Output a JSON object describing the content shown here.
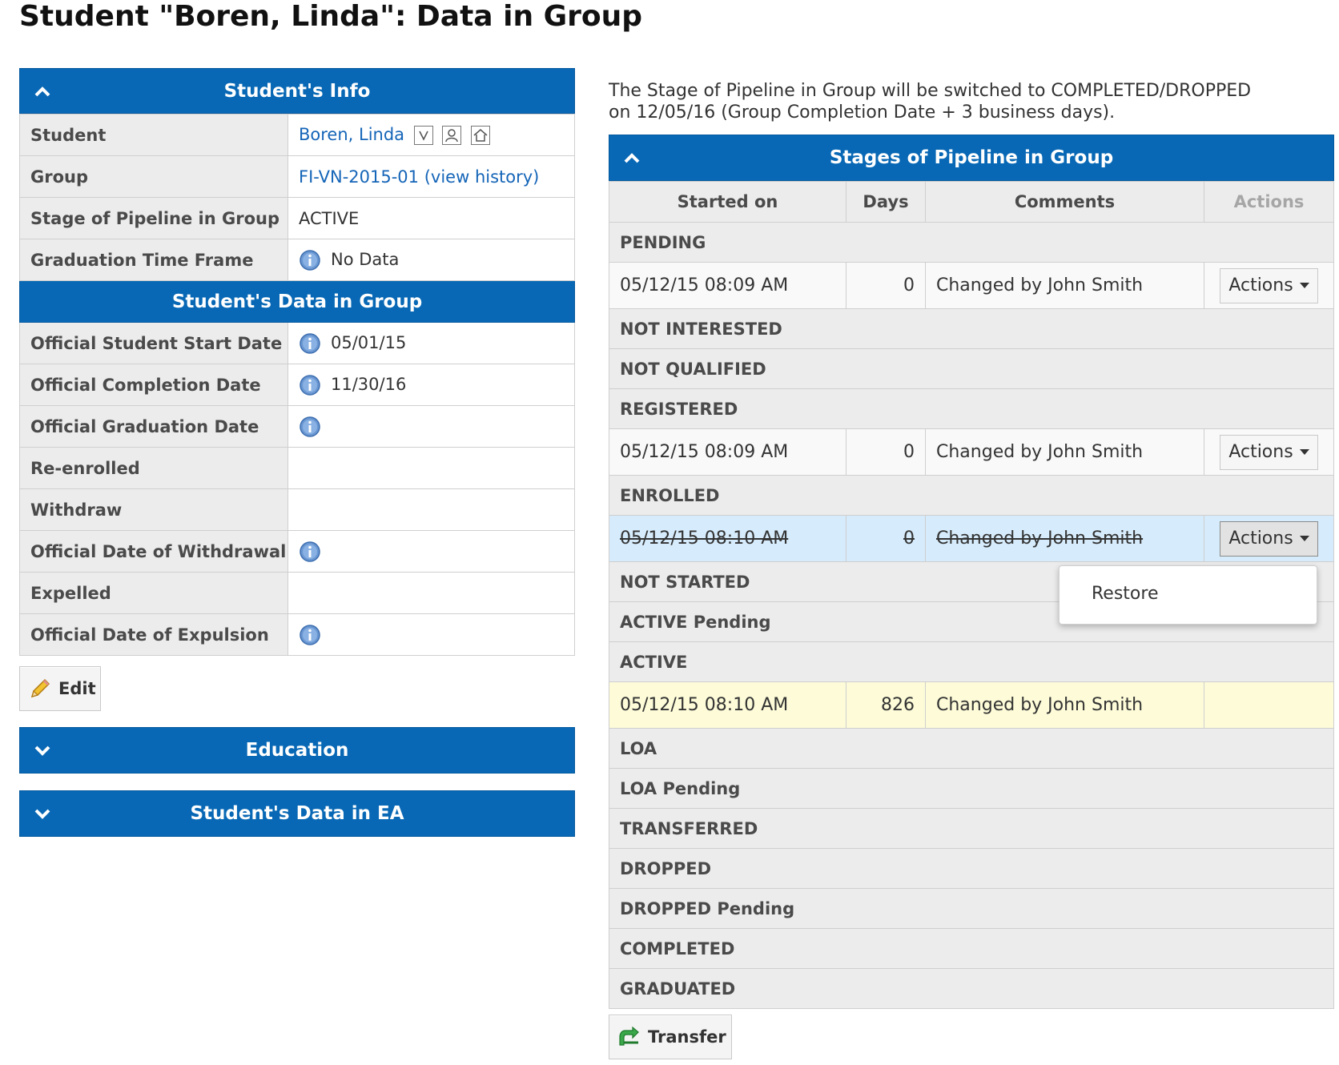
{
  "page": {
    "title": "Student \"Boren, Linda\": Data in Group"
  },
  "students_info": {
    "header": "Student's Info",
    "rows": [
      {
        "label": "Student",
        "value": "Boren, Linda"
      },
      {
        "label": "Group",
        "value": "FI-VN-2015-01",
        "extra_open": "(",
        "extra_link": "view history",
        "extra_close": ")"
      },
      {
        "label": "Stage of Pipeline in Group",
        "value": "ACTIVE"
      },
      {
        "label": "Graduation Time Frame",
        "value": "No Data"
      }
    ],
    "student_icons": [
      "v-icon",
      "person-icon",
      "home-icon"
    ]
  },
  "students_data_in_group": {
    "header": "Student's Data in Group",
    "rows": [
      {
        "label": "Official Student Start Date",
        "value": "05/01/15"
      },
      {
        "label": "Official Completion Date",
        "value": "11/30/16"
      },
      {
        "label": "Official Graduation Date",
        "value": ""
      },
      {
        "label": "Re-enrolled",
        "value": ""
      },
      {
        "label": "Withdraw",
        "value": ""
      },
      {
        "label": "Official Date of Withdrawal",
        "value": ""
      },
      {
        "label": "Expelled",
        "value": ""
      },
      {
        "label": "Official Date of Expulsion",
        "value": ""
      }
    ]
  },
  "buttons": {
    "edit": "Edit",
    "transfer": "Transfer"
  },
  "collapsed_panels": {
    "education": "Education",
    "ea": "Student's Data in EA"
  },
  "notice": {
    "line1": "The Stage of Pipeline in Group will be switched to COMPLETED/DROPPED",
    "line2": "on 12/05/16 (Group Completion Date + 3 business days)."
  },
  "stages_panel": {
    "header": "Stages of Pipeline in Group",
    "columns": [
      "Started on",
      "Days",
      "Comments",
      "Actions"
    ],
    "stages": {
      "pending": "PENDING",
      "not_interested": "NOT INTERESTED",
      "not_qualified": "NOT QUALIFIED",
      "registered": "REGISTERED",
      "enrolled": "ENROLLED",
      "not_started": "NOT STARTED",
      "active_pending": "ACTIVE Pending",
      "active": "ACTIVE",
      "loa": "LOA",
      "loa_pending": "LOA Pending",
      "transferred": "TRANSFERRED",
      "dropped": "DROPPED",
      "dropped_pending": "DROPPED Pending",
      "completed": "COMPLETED",
      "graduated": "GRADUATED"
    },
    "entries": {
      "pending": {
        "started": "05/12/15 08:09 AM",
        "days": "0",
        "comment": "Changed by John Smith",
        "action": "Actions"
      },
      "registered": {
        "started": "05/12/15 08:09 AM",
        "days": "0",
        "comment": "Changed by John Smith",
        "action": "Actions"
      },
      "enrolled": {
        "started": "05/12/15 08:10 AM",
        "days": "0",
        "comment": "Changed by John Smith",
        "action": "Actions",
        "struck": true
      },
      "active": {
        "started": "05/12/15 08:10 AM",
        "days": "826",
        "comment": "Changed by John Smith",
        "action": ""
      }
    }
  },
  "dropdown_menu": {
    "items": [
      "Restore"
    ]
  },
  "colors": {
    "header_blue": "#0868b5",
    "link_blue": "#1565b8",
    "highlight_blue": "#d6ebfb",
    "current_yellow": "#fdfbd8",
    "label_gray": "#ececec"
  }
}
